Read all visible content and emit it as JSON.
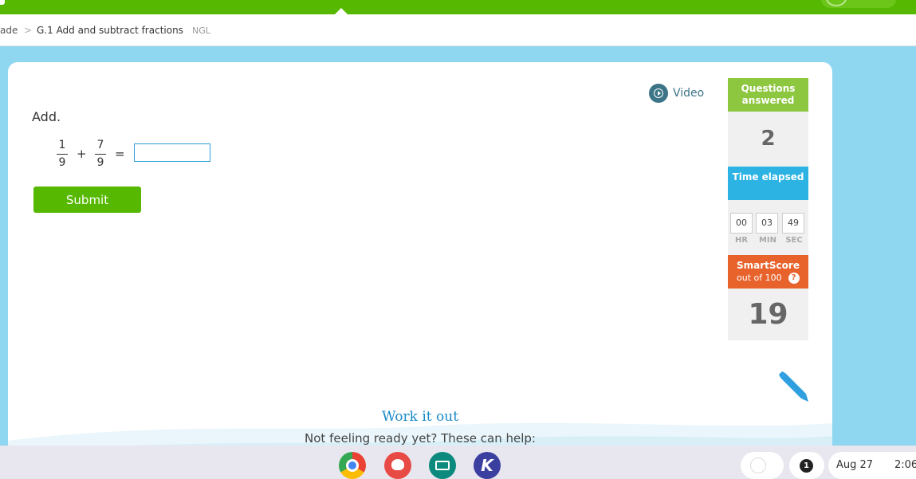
{
  "breadcrumb": {
    "previous": "ade",
    "separator": ">",
    "current": "G.1 Add and subtract fractions",
    "tag": "NGL"
  },
  "video": {
    "label": "Video"
  },
  "question": {
    "prompt": "Add.",
    "fraction1": {
      "numerator": "1",
      "denominator": "9"
    },
    "plus": "+",
    "fraction2": {
      "numerator": "7",
      "denominator": "9"
    },
    "equals": "=",
    "answer_value": ""
  },
  "submit_label": "Submit",
  "stats": {
    "questions_answered_label": "Questions answered",
    "questions_answered_value": "2",
    "time_elapsed_label": "Time elapsed",
    "time": {
      "hr": "00",
      "min": "03",
      "sec": "49"
    },
    "time_units": {
      "hr": "HR",
      "min": "MIN",
      "sec": "SEC"
    },
    "smartscore_label": "SmartScore",
    "smartscore_sub": "out of 100",
    "smartscore_help": "?",
    "smartscore_value": "19"
  },
  "work_it_out": {
    "title": "Work it out",
    "subtitle": "Not feeling ready yet? These can help:"
  },
  "shelf": {
    "apps": [
      "chrome-icon",
      "palette-icon",
      "slides-icon",
      "k-app-icon"
    ],
    "k_letter": "K",
    "notification_count": "1",
    "date": "Aug 27",
    "time": "2:06"
  },
  "colors": {
    "brand_green": "#56b800",
    "stat_green": "#8dc63f",
    "stat_blue": "#2cb3e4",
    "stat_orange": "#e8622c",
    "link_blue": "#1a8ac8",
    "page_bg": "#8fd6f0"
  }
}
